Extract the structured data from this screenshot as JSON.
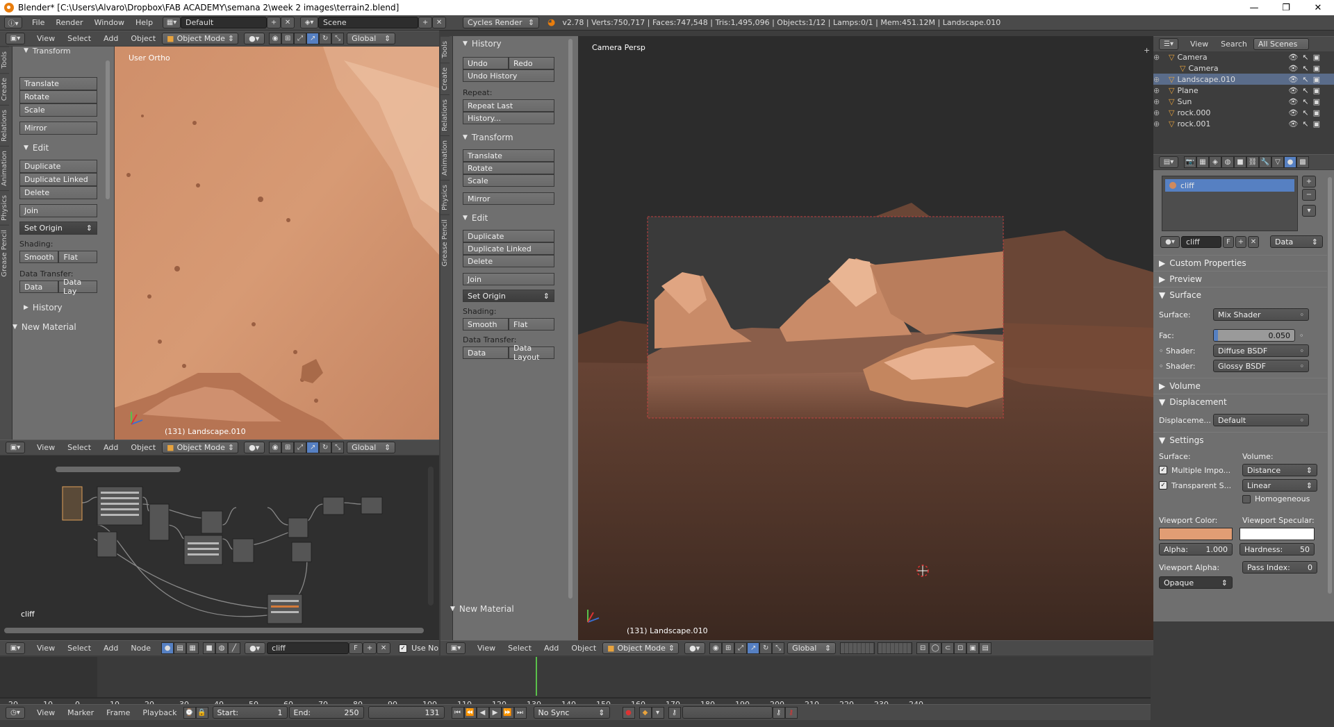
{
  "window": {
    "title": "Blender* [C:\\Users\\Alvaro\\Dropbox\\FAB ACADEMY\\semana 2\\week 2 images\\terrain2.blend]",
    "min": "—",
    "max": "❐",
    "close": "✕"
  },
  "mainbar": {
    "menus": [
      "File",
      "Render",
      "Window",
      "Help"
    ],
    "layout": "Default",
    "scene": "Scene",
    "engine": "Cycles Render",
    "stats": "v2.78 | Verts:750,717 | Faces:747,548 | Tris:1,495,096 | Objects:1/12 | Lamps:0/1 | Mem:451.12M | Landscape.010"
  },
  "left_tools": {
    "tabs": [
      "Tools",
      "Create",
      "Relations",
      "Animation",
      "Physics",
      "Grease Pencil"
    ],
    "transform_title": "Transform",
    "transform": [
      "Translate",
      "Rotate",
      "Scale"
    ],
    "mirror": "Mirror",
    "edit_title": "Edit",
    "edit": [
      "Duplicate",
      "Duplicate Linked",
      "Delete"
    ],
    "join": "Join",
    "set_origin": "Set Origin",
    "shading_label": "Shading:",
    "smooth": "Smooth",
    "flat": "Flat",
    "transfer_label": "Data Transfer:",
    "data": "Data",
    "data_lay": "Data Lay",
    "history": "History",
    "new_material": "New Material"
  },
  "top_view": {
    "label": "User Ortho",
    "object": "(131) Landscape.010"
  },
  "view_header": {
    "menus": [
      "View",
      "Select",
      "Add",
      "Object"
    ],
    "mode": "Object Mode",
    "orientation": "Global"
  },
  "node_editor": {
    "menus": [
      "View",
      "Select",
      "Add",
      "Node"
    ],
    "material": "cliff",
    "fake": "F",
    "use_nodes": "Use No",
    "label": "cliff"
  },
  "mid_tools": {
    "tabs": [
      "Tools",
      "Create",
      "Relations",
      "Animation",
      "Physics",
      "Grease Pencil"
    ],
    "history_title": "History",
    "undo": "Undo",
    "redo": "Redo",
    "undo_history": "Undo History",
    "repeat_label": "Repeat:",
    "repeat_last": "Repeat Last",
    "history_dots": "History...",
    "transform_title": "Transform",
    "transform": [
      "Translate",
      "Rotate",
      "Scale"
    ],
    "mirror": "Mirror",
    "edit_title": "Edit",
    "edit": [
      "Duplicate",
      "Duplicate Linked",
      "Delete"
    ],
    "join": "Join",
    "set_origin": "Set Origin",
    "shading_label": "Shading:",
    "smooth": "Smooth",
    "flat": "Flat",
    "transfer_label": "Data Transfer:",
    "data": "Data",
    "data_layout": "Data Layout",
    "new_material": "New Material"
  },
  "camera_view": {
    "label": "Camera Persp",
    "object": "(131) Landscape.010"
  },
  "outliner": {
    "menus": [
      "View",
      "Search"
    ],
    "filter": "All Scenes",
    "items": [
      {
        "name": "Camera",
        "indent": 1
      },
      {
        "name": "Camera",
        "indent": 2
      },
      {
        "name": "Landscape.010",
        "indent": 1,
        "selected": true
      },
      {
        "name": "Plane",
        "indent": 1
      },
      {
        "name": "Sun",
        "indent": 1
      },
      {
        "name": "rock.000",
        "indent": 1
      },
      {
        "name": "rock.001",
        "indent": 1
      }
    ]
  },
  "properties": {
    "slot": "cliff",
    "material": "cliff",
    "fake": "F",
    "link": "Data",
    "sections": {
      "custom": "Custom Properties",
      "preview": "Preview",
      "surface": "Surface",
      "volume": "Volume",
      "displacement": "Displacement",
      "settings": "Settings"
    },
    "surface_label": "Surface:",
    "surface_value": "Mix Shader",
    "fac_label": "Fac:",
    "fac_value": "0.050",
    "fac_fraction": 0.05,
    "shader_label": "Shader:",
    "shader1": "Diffuse BSDF",
    "shader2": "Glossy BSDF",
    "disp_label": "Displaceme...",
    "disp_value": "Default",
    "settings_surface": "Surface:",
    "settings_volume": "Volume:",
    "multiple": "Multiple Impo...",
    "transparent": "Transparent S...",
    "distance": "Distance",
    "linear": "Linear",
    "homogeneous": "Homogeneous",
    "viewport_color": "Viewport Color:",
    "viewport_specular": "Viewport Specular:",
    "alpha_label": "Alpha:",
    "alpha_value": "1.000",
    "hardness_label": "Hardness:",
    "hardness_value": "50",
    "viewport_alpha": "Viewport Alpha:",
    "pass_index_label": "Pass Index:",
    "pass_index_value": "0",
    "opaque": "Opaque",
    "color_hex": "#e19d74"
  },
  "cam_header": {
    "menus": [
      "View",
      "Select",
      "Add",
      "Object"
    ],
    "mode": "Object Mode",
    "orientation": "Global"
  },
  "timeline": {
    "ticks": [
      "-20",
      "-10",
      "0",
      "10",
      "20",
      "30",
      "40",
      "50",
      "60",
      "70",
      "80",
      "90",
      "100",
      "110",
      "120",
      "130",
      "140",
      "150",
      "160",
      "170",
      "180",
      "190",
      "200",
      "210",
      "220",
      "230",
      "240"
    ],
    "current": 131,
    "menus": [
      "View",
      "Marker",
      "Frame",
      "Playback"
    ],
    "start_label": "Start:",
    "start": "1",
    "end_label": "End:",
    "end": "250",
    "frame": "131",
    "sync": "No Sync"
  }
}
